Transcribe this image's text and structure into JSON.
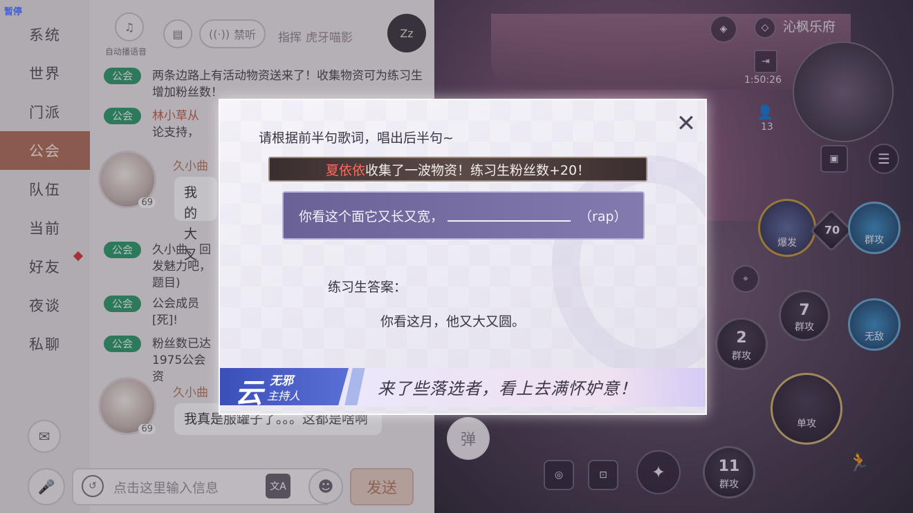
{
  "overlay": {
    "pause_label": "暂停"
  },
  "game": {
    "guild_name": "沁枫乐府",
    "exit_count": "1:50:26",
    "player_count": "13",
    "skills": [
      {
        "num": "",
        "label": "爆发"
      },
      {
        "num": "70",
        "label": ""
      },
      {
        "num": "",
        "label": "群攻"
      },
      {
        "num": "7",
        "label": "群攻"
      },
      {
        "num": "",
        "label": "无敌"
      },
      {
        "num": "2",
        "label": "群攻"
      },
      {
        "num": "",
        "label": "单攻"
      },
      {
        "num": "11",
        "label": "群攻"
      }
    ],
    "danmaku_label": "弹"
  },
  "chat": {
    "sidebar": [
      {
        "label": "系统"
      },
      {
        "label": "世界"
      },
      {
        "label": "门派"
      },
      {
        "label": "公会"
      },
      {
        "label": "队伍"
      },
      {
        "label": "当前"
      },
      {
        "label": "好友"
      },
      {
        "label": "夜谈"
      },
      {
        "label": "私聊"
      }
    ],
    "top": {
      "auto_voice": "自动播语音",
      "mute": "禁听",
      "conductor_label": "指挥",
      "conductor_name": "虎牙喵影"
    },
    "messages": [
      {
        "tag": "公会",
        "text": "两条边路上有活动物资送来了！收集物资可为练习生增加粉丝数！"
      },
      {
        "tag": "公会",
        "name": "林小草从",
        "text": "论支持，"
      },
      {
        "user": "久小曲",
        "level": "69",
        "bubble": "我的大又"
      },
      {
        "tag": "公会",
        "text": "久小曲、回发魅力吧，题目)"
      },
      {
        "tag": "公会",
        "text": "公会成员[死]!"
      },
      {
        "tag": "公会",
        "text": "粉丝数已达1975公会资"
      },
      {
        "user": "久小曲",
        "level": "69",
        "bubble": "我真是服罐子了。。。这都是啥啊"
      }
    ],
    "input": {
      "placeholder": "点击这里输入信息",
      "send": "发送"
    }
  },
  "dialog": {
    "title": "请根据前半句歌词，唱出后半句~",
    "notice_who": "夏依依",
    "notice_text": "收集了一波物资！练习生粉丝数+20！",
    "lyric_prefix": "你看这个面它又长又宽，",
    "lyric_suffix": "（rap）",
    "answer_label": "练习生答案：",
    "answer_text": "你看这月，他又大又圆。",
    "host_char": "云",
    "host_name": "无邪",
    "host_role": "主持人",
    "host_line": "来了些落选者，看上去满怀妒意！"
  }
}
